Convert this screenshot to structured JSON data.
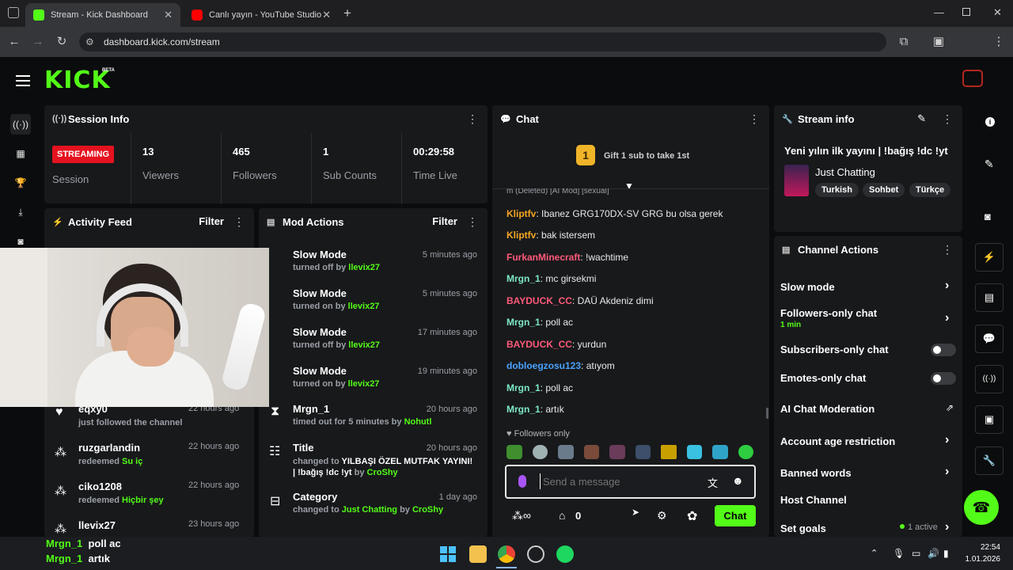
{
  "browser": {
    "tabs": [
      {
        "label": "Stream - Kick Dashboard",
        "active": true
      },
      {
        "label": "Canlı yayın - YouTube Studio",
        "active": false
      }
    ],
    "url": "dashboard.kick.com/stream"
  },
  "header": {
    "logo": "KICK",
    "beta": "BETA"
  },
  "session": {
    "title": "Session Info",
    "badge": "STREAMING",
    "badge_label": "Session",
    "stats": [
      {
        "value": "13",
        "label": "Viewers"
      },
      {
        "value": "465",
        "label": "Followers"
      },
      {
        "value": "1",
        "label": "Sub Counts"
      },
      {
        "value": "00:29:58",
        "label": "Time Live"
      }
    ]
  },
  "activity": {
    "title": "Activity Feed",
    "filter": "Filter",
    "items": [
      {
        "name": "eqxy0",
        "text": "just followed the channel",
        "reward": "",
        "time": "22 hours ago"
      },
      {
        "name": "ruzgarlandin",
        "text": "redeemed",
        "reward": "Su iç",
        "time": "22 hours ago"
      },
      {
        "name": "ciko1208",
        "text": "redeemed",
        "reward": "Hiçbir şey",
        "time": "22 hours ago"
      },
      {
        "name": "llevix27",
        "text": "",
        "reward": "",
        "time": "23 hours ago"
      }
    ]
  },
  "mod": {
    "title": "Mod Actions",
    "filter": "Filter",
    "items": [
      {
        "title": "Slow Mode",
        "sub": "turned off by",
        "by": "llevix27",
        "extra": "",
        "time": "5 minutes ago"
      },
      {
        "title": "Slow Mode",
        "sub": "turned on by",
        "by": "llevix27",
        "extra": "",
        "time": "5 minutes ago"
      },
      {
        "title": "Slow Mode",
        "sub": "turned off by",
        "by": "llevix27",
        "extra": "",
        "time": "17 minutes ago"
      },
      {
        "title": "Slow Mode",
        "sub": "turned on by",
        "by": "llevix27",
        "extra": "",
        "time": "19 minutes ago"
      },
      {
        "title": "Mrgn_1",
        "sub": "timed out for 5 minutes by",
        "by": "Nohutl",
        "extra": "",
        "time": "20 hours ago"
      },
      {
        "title": "Title",
        "sub": "changed to",
        "by": "CroShy",
        "extra": "YILBAŞI ÖZEL MUTFAK YAYINI! | !bağış !dc !yt",
        "time": "20 hours ago"
      },
      {
        "title": "Category",
        "sub": "changed to",
        "by": "CroShy",
        "extra": "Just Chatting",
        "time": "1 day ago"
      }
    ]
  },
  "chat": {
    "title": "Chat",
    "gift": "Gift 1 sub to take 1st",
    "gift_count": "1",
    "deleted_line": "m (Deleted) [AI Mod] [sexual]",
    "messages": [
      {
        "user": "Kliptfv",
        "color": "#f5a623",
        "text": "Ibanez GRG170DX-SV GRG bu olsa gerek"
      },
      {
        "user": "Kliptfv",
        "color": "#f5a623",
        "text": "bak istersem"
      },
      {
        "user": "FurkanMinecraft",
        "color": "#ff5a7a",
        "text": "!wachtime"
      },
      {
        "user": "Mrgn_1",
        "color": "#7ee8c9",
        "text": "mc girsekmi"
      },
      {
        "user": "BAYDUCK_CC",
        "color": "#ff5a7a",
        "text": "DAÜ Akdeniz dimi"
      },
      {
        "user": "Mrgn_1",
        "color": "#7ee8c9",
        "text": "poll ac"
      },
      {
        "user": "BAYDUCK_CC",
        "color": "#ff5a7a",
        "text": "yurdun"
      },
      {
        "user": "dobloegzosu123",
        "color": "#4aa3ff",
        "text": "atıyom"
      },
      {
        "user": "Mrgn_1",
        "color": "#7ee8c9",
        "text": "poll ac"
      },
      {
        "user": "Mrgn_1",
        "color": "#7ee8c9",
        "text": "artık"
      }
    ],
    "followers_only": "Followers only",
    "placeholder": "Send a message",
    "points": "0",
    "send": "Chat"
  },
  "stream_info": {
    "title": "Stream info",
    "stream_title": "Yeni yılın ilk yayını | !bağış !dc !yt",
    "category": "Just Chatting",
    "tags": [
      "Turkish",
      "Sohbet",
      "Türkçe"
    ]
  },
  "channel_actions": {
    "title": "Channel Actions",
    "items": [
      {
        "label": "Slow mode",
        "sub": "",
        "control": "chevron"
      },
      {
        "label": "Followers-only chat",
        "sub": "1 min",
        "control": "chevron"
      },
      {
        "label": "Subscribers-only chat",
        "sub": "",
        "control": "toggle"
      },
      {
        "label": "Emotes-only chat",
        "sub": "",
        "control": "toggle"
      },
      {
        "label": "AI Chat Moderation",
        "sub": "",
        "control": "external"
      },
      {
        "label": "Account age restriction",
        "sub": "",
        "control": "chevron"
      },
      {
        "label": "Banned words",
        "sub": "",
        "control": "chevron"
      },
      {
        "label": "Host Channel",
        "sub": "",
        "control": "none"
      },
      {
        "label": "Set goals",
        "sub": "",
        "control": "chevron"
      }
    ],
    "goals_active": "1 active"
  },
  "overlay_chat": [
    {
      "user": "Mrgn_1",
      "text": "poll ac"
    },
    {
      "user": "Mrgn_1",
      "text": "artık"
    }
  ],
  "taskbar": {
    "time": "22:54",
    "date": "1.01.2026"
  }
}
